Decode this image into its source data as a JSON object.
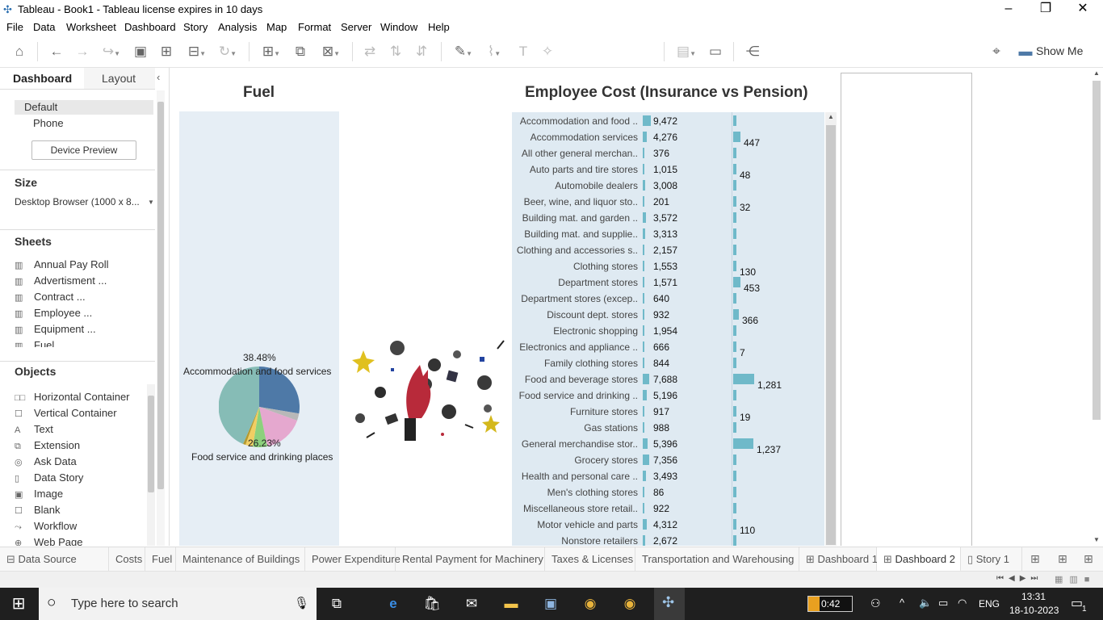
{
  "window": {
    "title": "Tableau - Book1 - Tableau license expires in 10 days"
  },
  "menu": [
    "File",
    "Data",
    "Worksheet",
    "Dashboard",
    "Story",
    "Analysis",
    "Map",
    "Format",
    "Server",
    "Window",
    "Help"
  ],
  "toolbar": {
    "show_me": "Show Me"
  },
  "left_panel": {
    "tabs": {
      "dashboard": "Dashboard",
      "layout": "Layout"
    },
    "devices": [
      "Default",
      "Phone"
    ],
    "device_preview": "Device Preview",
    "size_title": "Size",
    "size_value": "Desktop Browser (1000 x 8...",
    "sheets_title": "Sheets",
    "sheets": [
      "Annual Pay Roll",
      "Advertisment ...",
      "Contract ...",
      "Employee ...",
      "Equipment ...",
      "Fuel"
    ],
    "objects_title": "Objects",
    "objects": [
      {
        "label": "Horizontal Container",
        "icon": "horizontal-container-icon",
        "glyph": "□□"
      },
      {
        "label": "Vertical Container",
        "icon": "vertical-container-icon",
        "glyph": "☐"
      },
      {
        "label": "Text",
        "icon": "text-icon",
        "glyph": "A"
      },
      {
        "label": "Extension",
        "icon": "extension-icon",
        "glyph": "⧉"
      },
      {
        "label": "Ask Data",
        "icon": "ask-data-icon",
        "glyph": "◎"
      },
      {
        "label": "Data Story",
        "icon": "data-story-icon",
        "glyph": "▯"
      },
      {
        "label": "Image",
        "icon": "image-icon",
        "glyph": "▣"
      },
      {
        "label": "Blank",
        "icon": "blank-icon",
        "glyph": "☐"
      },
      {
        "label": "Workflow",
        "icon": "workflow-icon",
        "glyph": "⤳"
      },
      {
        "label": "Web Page",
        "icon": "web-page-icon",
        "glyph": "⊕"
      }
    ]
  },
  "dashboard": {
    "fuel_title": "Fuel",
    "pie_label_top_pct": "38.48%",
    "pie_label_top_name": "Accommodation and food services",
    "pie_label_bottom_pct": "26.23%",
    "pie_label_bottom_name": "Food service and drinking places",
    "employee_title": "Employee Cost (Insurance vs Pension)"
  },
  "chart_data": {
    "type": "bar",
    "title": "Employee Cost (Insurance vs Pension)",
    "categories": [
      "Accommodation and food ..",
      "Accommodation services",
      "All other general merchan..",
      "Auto parts and tire stores",
      "Automobile dealers",
      "Beer, wine, and liquor sto..",
      "Building mat. and garden ..",
      "Building mat. and supplie..",
      "Clothing and accessories s..",
      "Clothing stores",
      "Department stores",
      "Department stores (excep..",
      "Discount dept. stores",
      "Electronic shopping",
      "Electronics and appliance ..",
      "Family clothing stores",
      "Food and beverage stores",
      "Food service and drinking ..",
      "Furniture stores",
      "Gas stations",
      "General merchandise stor..",
      "Grocery stores",
      "Health and personal care ..",
      "Men's clothing stores",
      "Miscellaneous store retail..",
      "Motor vehicle and parts",
      "Nonstore retailers"
    ],
    "series": [
      {
        "values": [
          9472,
          4276,
          376,
          1015,
          3008,
          201,
          3572,
          3313,
          2157,
          1553,
          1571,
          640,
          932,
          1954,
          666,
          844,
          7688,
          5196,
          917,
          988,
          5396,
          7356,
          3493,
          86,
          922,
          4312,
          2672
        ]
      },
      {
        "values": [
          null,
          447,
          null,
          48,
          null,
          32,
          null,
          null,
          null,
          130,
          453,
          null,
          366,
          null,
          7,
          null,
          1281,
          null,
          19,
          null,
          1237,
          null,
          null,
          null,
          null,
          110,
          null
        ]
      }
    ],
    "series2_labels": [
      "",
      "447",
      "",
      "48",
      "",
      "32",
      "",
      "",
      "",
      "130",
      "453",
      "",
      "366",
      "",
      "7",
      "",
      "1,281",
      "",
      "19",
      "",
      "1,237",
      "",
      "",
      "",
      "",
      "110",
      ""
    ],
    "series1_labels": [
      "9,472",
      "4,276",
      "376",
      "1,015",
      "3,008",
      "201",
      "3,572",
      "3,313",
      "2,157",
      "1,553",
      "1,571",
      "640",
      "932",
      "1,954",
      "666",
      "844",
      "7,688",
      "5,196",
      "917",
      "988",
      "5,396",
      "7,356",
      "3,493",
      "86",
      "922",
      "4,312",
      "2,672"
    ]
  },
  "sheet_tabs": [
    {
      "label": "Data Source",
      "icon": "data-source-icon"
    },
    {
      "label": "Costs"
    },
    {
      "label": "Fuel"
    },
    {
      "label": "Maintenance of Buildings"
    },
    {
      "label": "Power Expenditure"
    },
    {
      "label": "Rental Payment for Machinery"
    },
    {
      "label": "Taxes & Licenses"
    },
    {
      "label": "Transportation and Warehousing"
    },
    {
      "label": "Dashboard 1",
      "icon": "dashboard-icon"
    },
    {
      "label": "Dashboard 2",
      "icon": "dashboard-icon",
      "active": true
    },
    {
      "label": "Story 1",
      "icon": "story-icon"
    }
  ],
  "taskbar": {
    "search_placeholder": "Type here to search",
    "battery": "0:42",
    "lang": "ENG",
    "time": "13:31",
    "date": "18-10-2023",
    "notifications": "1"
  },
  "colors": {
    "bar": "#6fb9c9",
    "pie_blue": "#4e79a7",
    "pie_teal": "#86bcb6",
    "pie_pink": "#e5a8cf"
  }
}
